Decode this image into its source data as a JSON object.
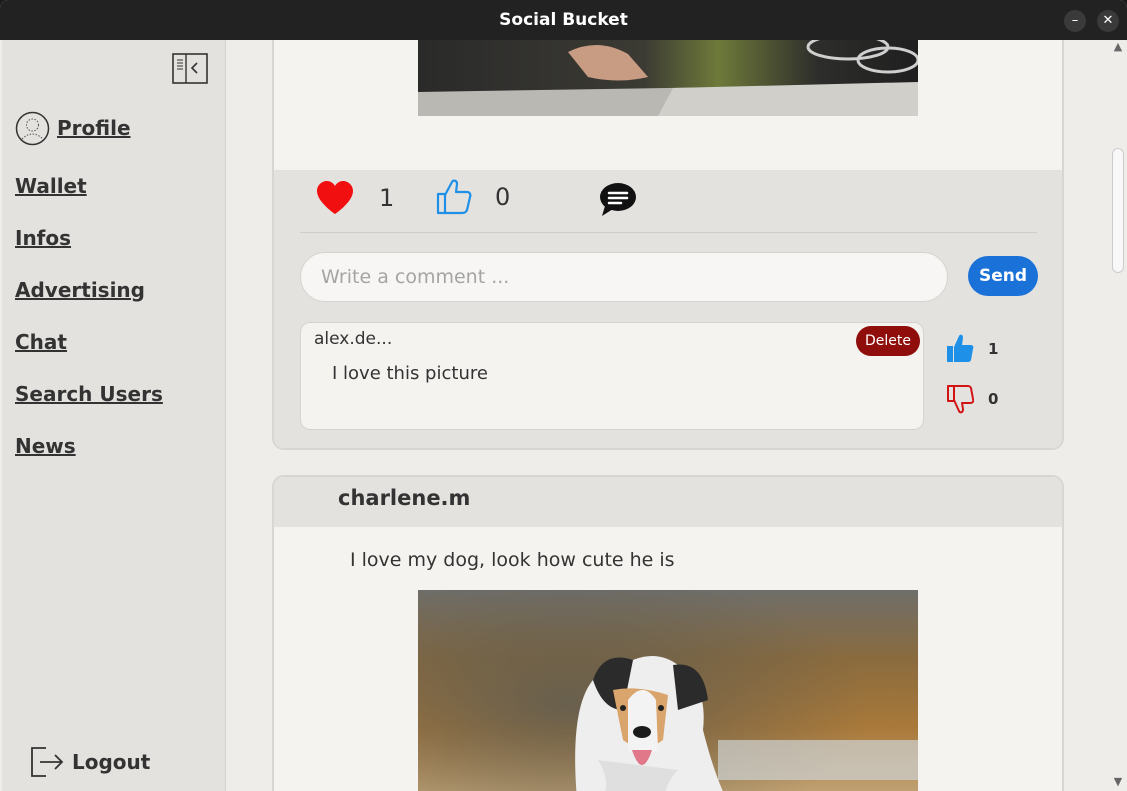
{
  "window": {
    "title": "Social Bucket",
    "minimize": "–",
    "close": "✕"
  },
  "sidebar": {
    "profile_label": "Profile",
    "items": [
      {
        "label": "Wallet"
      },
      {
        "label": "Infos"
      },
      {
        "label": "Advertising"
      },
      {
        "label": "Chat"
      },
      {
        "label": "Search Users"
      },
      {
        "label": "News"
      }
    ],
    "logout_label": "Logout"
  },
  "post1": {
    "likes_heart": "1",
    "likes_thumb": "0",
    "comment_placeholder": "Write a comment ...",
    "send_label": "Send",
    "comment": {
      "author": "alex.de...",
      "text": "I love this picture",
      "delete_label": "Delete",
      "up_count": "1",
      "down_count": "0"
    }
  },
  "post2": {
    "author": "charlene.m",
    "text": "I love my dog, look how cute he is"
  },
  "colors": {
    "heart": "#f20f0f",
    "thumb_blue": "#1e90e8",
    "send_blue": "#1a72d8",
    "delete_red": "#8f0e0b",
    "dislike_red": "#d21313"
  },
  "scrollbar": {
    "up": "▲",
    "down": "▼"
  }
}
